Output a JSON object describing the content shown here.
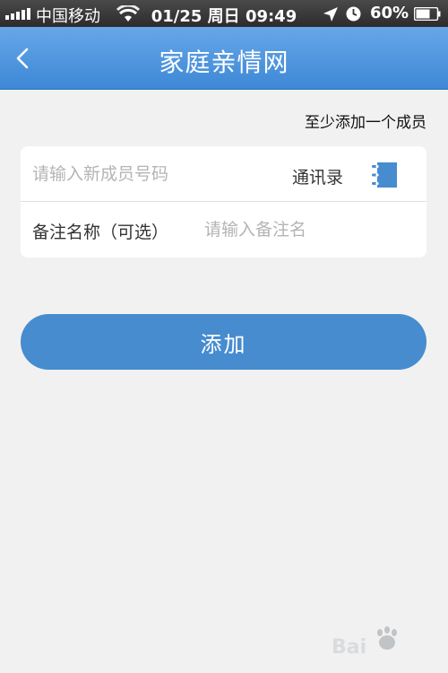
{
  "status_bar": {
    "carrier": "中国移动",
    "datetime": "01/25 周日 09:49",
    "battery": "60%"
  },
  "nav": {
    "title": "家庭亲情网"
  },
  "hint": "至少添加一个成员",
  "form": {
    "number_placeholder": "请输入新成员号码",
    "number_value": "",
    "contacts_label": "通讯录",
    "remark_label": "备注名称（可选）",
    "remark_placeholder": "请输入备注名",
    "remark_value": ""
  },
  "add_button_label": "添加",
  "colors": {
    "nav_top": "#67a7e8",
    "nav_bottom": "#3d88d6",
    "button": "#468ccf",
    "background": "#f1f1f1"
  },
  "icons": {
    "back": "back-chevron-icon",
    "contacts": "contact-book-icon",
    "location": "location-arrow-icon",
    "clock": "clock-icon",
    "wifi": "wifi-icon",
    "signal": "signal-bars-icon",
    "battery": "battery-icon"
  }
}
